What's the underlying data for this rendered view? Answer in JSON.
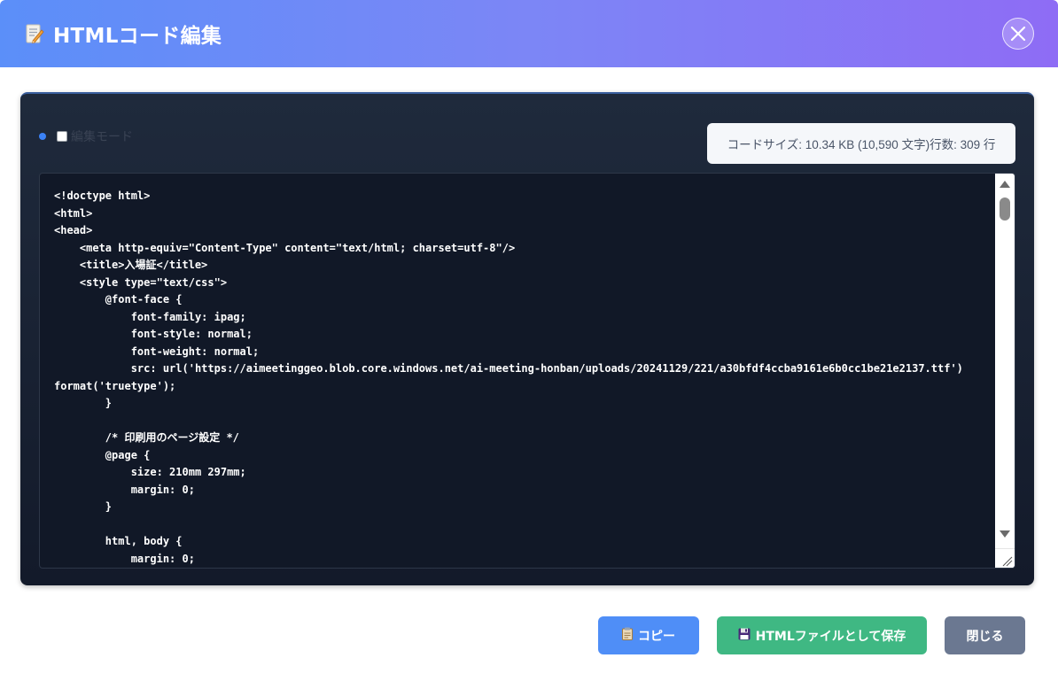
{
  "header": {
    "title": "HTMLコード編集",
    "title_icon": "memo-icon"
  },
  "editor": {
    "mode_label": "編集モード",
    "mode_checked": false,
    "size_info": "コードサイズ: 10.34 KB (10,590 文字)行数: 309 行",
    "code_lines": [
      "<!doctype html>",
      "<html>",
      "<head>",
      "    <meta http-equiv=\"Content-Type\" content=\"text/html; charset=utf-8\"/>",
      "    <title>入場証</title>",
      "    <style type=\"text/css\">",
      "        @font-face {",
      "            font-family: ipag;",
      "            font-style: normal;",
      "            font-weight: normal;",
      "            src: url('https://aimeetinggeo.blob.core.windows.net/ai-meeting-honban/uploads/20241129/221/a30bfdf4ccba9161e6b0cc1be21e2137.ttf')",
      "format('truetype');",
      "        }",
      "",
      "        /* 印刷用のページ設定 */",
      "        @page {",
      "            size: 210mm 297mm;",
      "            margin: 0;",
      "        }",
      "",
      "        html, body {",
      "            margin: 0;"
    ]
  },
  "buttons": {
    "copy_label": "コピー",
    "copy_icon": "clipboard-icon",
    "save_label": "HTMLファイルとして保存",
    "save_icon": "floppy-disk-icon",
    "close_label": "閉じる"
  },
  "colors": {
    "header_gradient_start": "#5b8ff9",
    "header_gradient_end": "#8e6cf5",
    "copy_button": "#4f8ef7",
    "save_button": "#3fb883",
    "close_button": "#6b7891",
    "editor_bg": "#111827"
  }
}
